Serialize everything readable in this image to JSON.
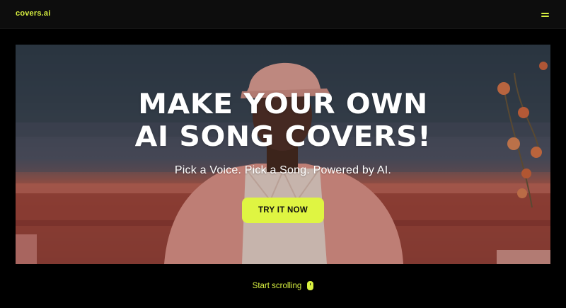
{
  "navbar": {
    "logo": "covers.ai",
    "menu_icon": "menu-icon"
  },
  "hero": {
    "headline_line1": "MAKE YOUR OWN",
    "headline_line2": "AI SONG COVERS!",
    "tagline": "Pick a Voice. Pick a Song. Powered by AI.",
    "cta_label": "TRY IT NOW"
  },
  "scroll": {
    "label": "Start scrolling",
    "icon": "mouse-icon"
  },
  "colors": {
    "accent": "#d8f040",
    "cta_background": "#dff542",
    "page_background": "#000000",
    "navbar_background": "#0d0d0d"
  }
}
